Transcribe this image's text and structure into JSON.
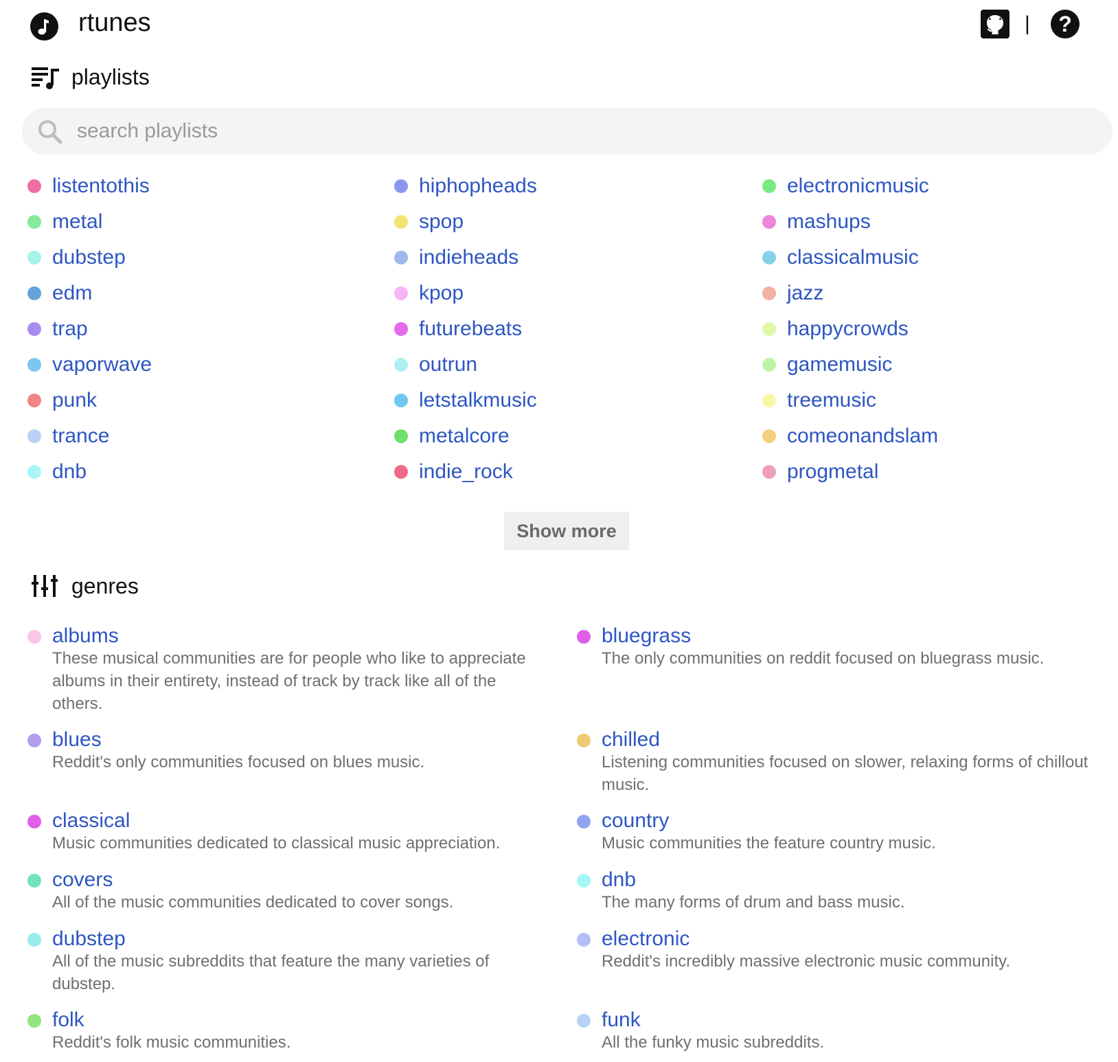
{
  "header": {
    "title": "rtunes",
    "logo_icon": "music-note-icon",
    "github_icon": "github-icon",
    "separator": "|",
    "help_icon": "help-icon",
    "help_glyph": "?"
  },
  "playlists_section": {
    "title": "playlists",
    "icon": "playlist-icon",
    "search": {
      "placeholder": "search playlists",
      "value": ""
    },
    "columns": [
      [
        {
          "name": "listentothis",
          "color": "#f06ea4"
        },
        {
          "name": "metal",
          "color": "#86ea9a"
        },
        {
          "name": "dubstep",
          "color": "#a6f3ea"
        },
        {
          "name": "edm",
          "color": "#64a3db"
        },
        {
          "name": "trap",
          "color": "#a98cf0"
        },
        {
          "name": "vaporwave",
          "color": "#7cc6f2"
        },
        {
          "name": "punk",
          "color": "#f08585"
        },
        {
          "name": "trance",
          "color": "#bdd0f6"
        },
        {
          "name": "dnb",
          "color": "#a7f5f6"
        }
      ],
      [
        {
          "name": "hiphopheads",
          "color": "#8c95ee"
        },
        {
          "name": "spop",
          "color": "#f3e473"
        },
        {
          "name": "indieheads",
          "color": "#9eb8ea"
        },
        {
          "name": "kpop",
          "color": "#f7b5f5"
        },
        {
          "name": "futurebeats",
          "color": "#e36aec"
        },
        {
          "name": "outrun",
          "color": "#aef0f2"
        },
        {
          "name": "letstalkmusic",
          "color": "#6cc8f0"
        },
        {
          "name": "metalcore",
          "color": "#6ee06b"
        },
        {
          "name": "indie_rock",
          "color": "#ef6a8a"
        }
      ],
      [
        {
          "name": "electronicmusic",
          "color": "#78ea83"
        },
        {
          "name": "mashups",
          "color": "#ef84dc"
        },
        {
          "name": "classicalmusic",
          "color": "#84d2ea"
        },
        {
          "name": "jazz",
          "color": "#f2b3a2"
        },
        {
          "name": "happycrowds",
          "color": "#e1f7a8"
        },
        {
          "name": "gamemusic",
          "color": "#bdf5a7"
        },
        {
          "name": "treemusic",
          "color": "#f8f7a8"
        },
        {
          "name": "comeonandslam",
          "color": "#f6cf7c"
        },
        {
          "name": "progmetal",
          "color": "#ef9ec0"
        }
      ]
    ],
    "show_more_label": "Show more"
  },
  "genres_section": {
    "title": "genres",
    "icon": "equalizer-icon",
    "left": [
      {
        "name": "albums",
        "color": "#f8c6e6",
        "desc": "These musical communities are for people who like to appreciate albums in their entirety, instead of track by track like all of the others."
      },
      {
        "name": "blues",
        "color": "#b29ded",
        "desc": "Reddit's only communities focused on blues music."
      },
      {
        "name": "classical",
        "color": "#e25fe7",
        "desc": "Music communities dedicated to classical music appreciation."
      },
      {
        "name": "covers",
        "color": "#70e2c0",
        "desc": "All of the music communities dedicated to cover songs."
      },
      {
        "name": "dubstep",
        "color": "#98ecea",
        "desc": "All of the music subreddits that feature the many varieties of dubstep."
      },
      {
        "name": "folk",
        "color": "#93e57d",
        "desc": "Reddit's folk music communities."
      }
    ],
    "right": [
      {
        "name": "bluegrass",
        "color": "#de5fe6",
        "desc": "The only communities on reddit focused on bluegrass music."
      },
      {
        "name": "chilled",
        "color": "#efca73",
        "desc": "Listening communities focused on slower, relaxing forms of chillout music."
      },
      {
        "name": "country",
        "color": "#92a3ee",
        "desc": "Music communities the feature country music."
      },
      {
        "name": "dnb",
        "color": "#a4f7f4",
        "desc": "The many forms of drum and bass music."
      },
      {
        "name": "electronic",
        "color": "#b4bdf6",
        "desc": "Reddit's incredibly massive electronic music community."
      },
      {
        "name": "funk",
        "color": "#b7d2f5",
        "desc": "All the funky music subreddits."
      }
    ]
  }
}
